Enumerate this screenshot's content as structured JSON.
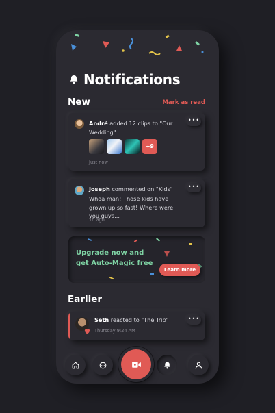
{
  "page": {
    "title": "Notifications"
  },
  "sections": {
    "new": "New",
    "mark_read": "Mark as read",
    "earlier": "Earlier"
  },
  "notifications": [
    {
      "user": "André",
      "text": " added 12 clips to \"Our Wedding\"",
      "time": "Just now",
      "extra_count": "+9"
    },
    {
      "user": "Joseph",
      "text": " commented on \"Kids\"",
      "comment": "Whoa man! Those kids have grown up so fast! Where were you guys...",
      "time": "1h ago"
    },
    {
      "user": "Seth",
      "text": " reacted to \"The Trip\"",
      "time": "Thursday 9:24 AM"
    }
  ],
  "promo": {
    "text": "Upgrade now and get Auto-Magic free",
    "button": "Learn more"
  },
  "more_label": "•••",
  "colors": {
    "accent": "#e05a55",
    "promo_text": "#7fd3a4",
    "background": "#2b2a31"
  },
  "nav": [
    "home-icon",
    "film-reel-icon",
    "video-camera-icon",
    "bell-icon",
    "user-icon"
  ]
}
